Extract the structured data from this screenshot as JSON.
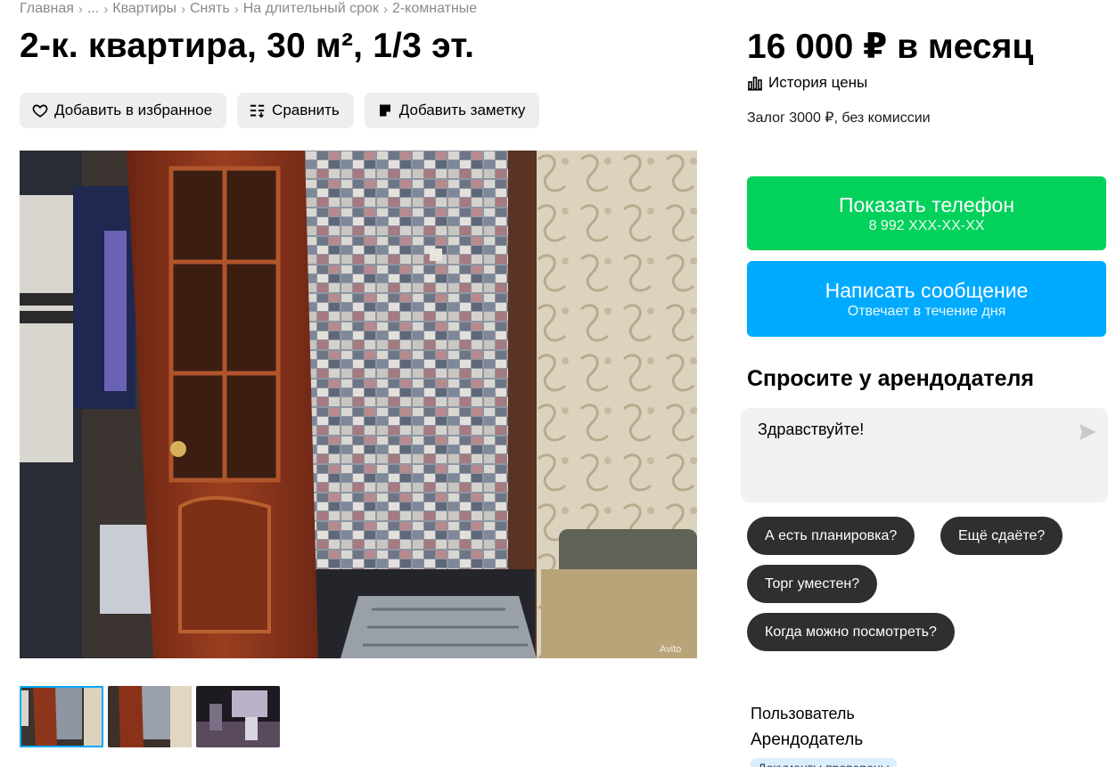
{
  "breadcrumb": [
    {
      "label": "Главная"
    },
    {
      "label": "..."
    },
    {
      "label": "Квартиры"
    },
    {
      "label": "Снять"
    },
    {
      "label": "На длительный срок"
    },
    {
      "label": "2-комнатные"
    }
  ],
  "breadcrumb_sep": "›",
  "title": "2-к. квартира, 30 м², 1/3 эт.",
  "actions": {
    "favorite": "Добавить в избранное",
    "compare": "Сравнить",
    "note": "Добавить заметку"
  },
  "photo": {
    "watermark": "Avito",
    "thumb_count": 3,
    "active_thumb": 1
  },
  "price": {
    "value": "16 000 ₽ в месяц",
    "history": "История цены",
    "deposit": "Залог 3000 ₽, без комиссии"
  },
  "contact": {
    "phone_label": "Показать телефон",
    "phone_number": "8 992 XXX-XX-XX",
    "message_label": "Написать сообщение",
    "message_sub": "Отвечает в течение дня"
  },
  "ask": {
    "title": "Спросите у арендодателя",
    "input_value": "Здравствуйте!",
    "chips": [
      "А есть планировка?",
      "Ещё сдаёте?",
      "Торг уместен?",
      "Когда можно посмотреть?"
    ]
  },
  "seller": {
    "role": "Пользователь",
    "name": "Арендодатель",
    "badge": "Документы проверены"
  },
  "colors": {
    "phone_button": "#02d15c",
    "message_button": "#00aaff",
    "chip_bg": "#2f2f2f",
    "action_bg": "#efeeec"
  }
}
